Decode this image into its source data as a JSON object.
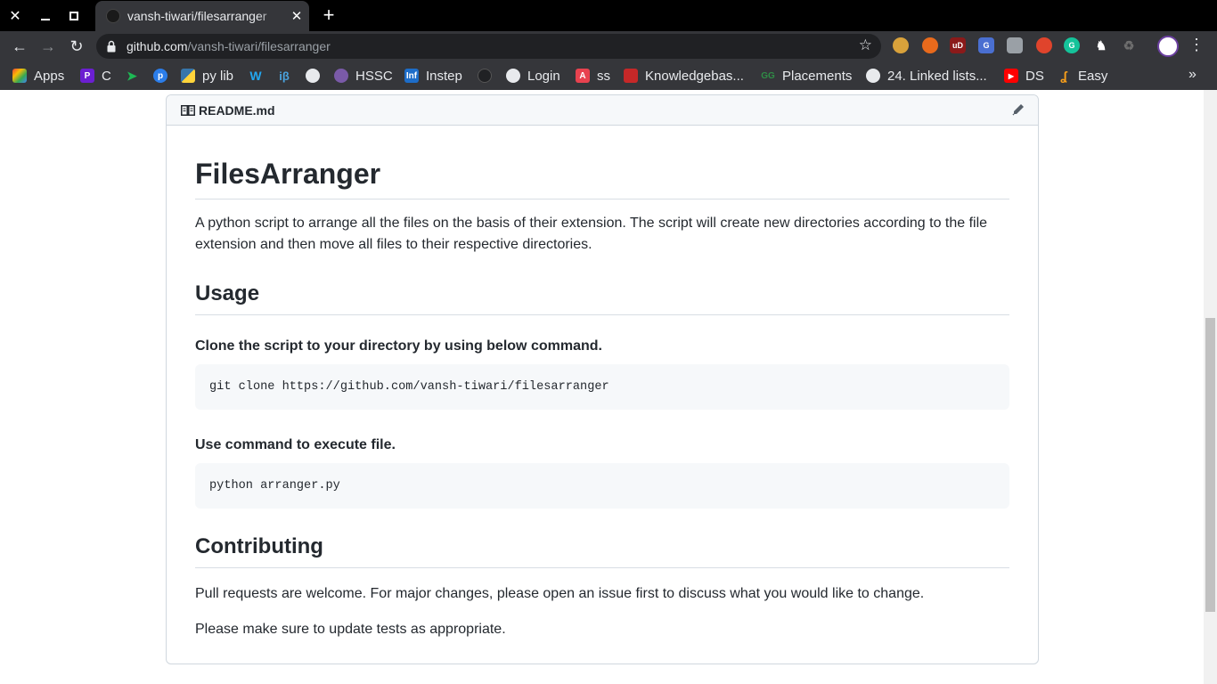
{
  "browser": {
    "tab": {
      "title": "vansh-tiwari/filesarranger"
    },
    "address": {
      "host": "github.com",
      "path": "/vansh-tiwari/filesarranger"
    },
    "bookmarks": [
      {
        "label": "Apps",
        "icon": "apps-grid-icon"
      },
      {
        "label": "C",
        "icon": "c-icon"
      },
      {
        "label": "",
        "icon": "arrow-icon"
      },
      {
        "label": "",
        "icon": "pypi-icon"
      },
      {
        "label": "py lib",
        "icon": "python-icon"
      },
      {
        "label": "",
        "icon": "w-icon"
      },
      {
        "label": "",
        "icon": "ib-icon"
      },
      {
        "label": "",
        "icon": "globe-icon"
      },
      {
        "label": "HSSC",
        "icon": "hssc-icon"
      },
      {
        "label": "Instep",
        "icon": "infosys-icon"
      },
      {
        "label": "",
        "icon": "github-icon"
      },
      {
        "label": "Login",
        "icon": "github-icon"
      },
      {
        "label": "ss",
        "icon": "a-icon"
      },
      {
        "label": "Knowledgebas...",
        "icon": "knowledgebase-icon"
      },
      {
        "label": "Placements",
        "icon": "gfg-icon"
      },
      {
        "label": "24. Linked lists...",
        "icon": "globe-icon"
      },
      {
        "label": "DS",
        "icon": "youtube-icon"
      },
      {
        "label": "Easy",
        "icon": "leetcode-icon"
      }
    ]
  },
  "readme": {
    "filename": "README.md",
    "title": "FilesArranger",
    "intro": "A python script to arrange all the files on the basis of their extension. The script will create new directories according to the file extension and then move all files to their respective directories.",
    "usage_heading": "Usage",
    "clone_label": "Clone the script to your directory by using below command.",
    "clone_cmd": "git clone https://github.com/vansh-tiwari/filesarranger",
    "exec_label": "Use command to execute file.",
    "exec_cmd": "python arranger.py",
    "contrib_heading": "Contributing",
    "contrib_p1": "Pull requests are welcome. For major changes, please open an issue first to discuss what you would like to change.",
    "contrib_p2": "Please make sure to update tests as appropriate."
  }
}
